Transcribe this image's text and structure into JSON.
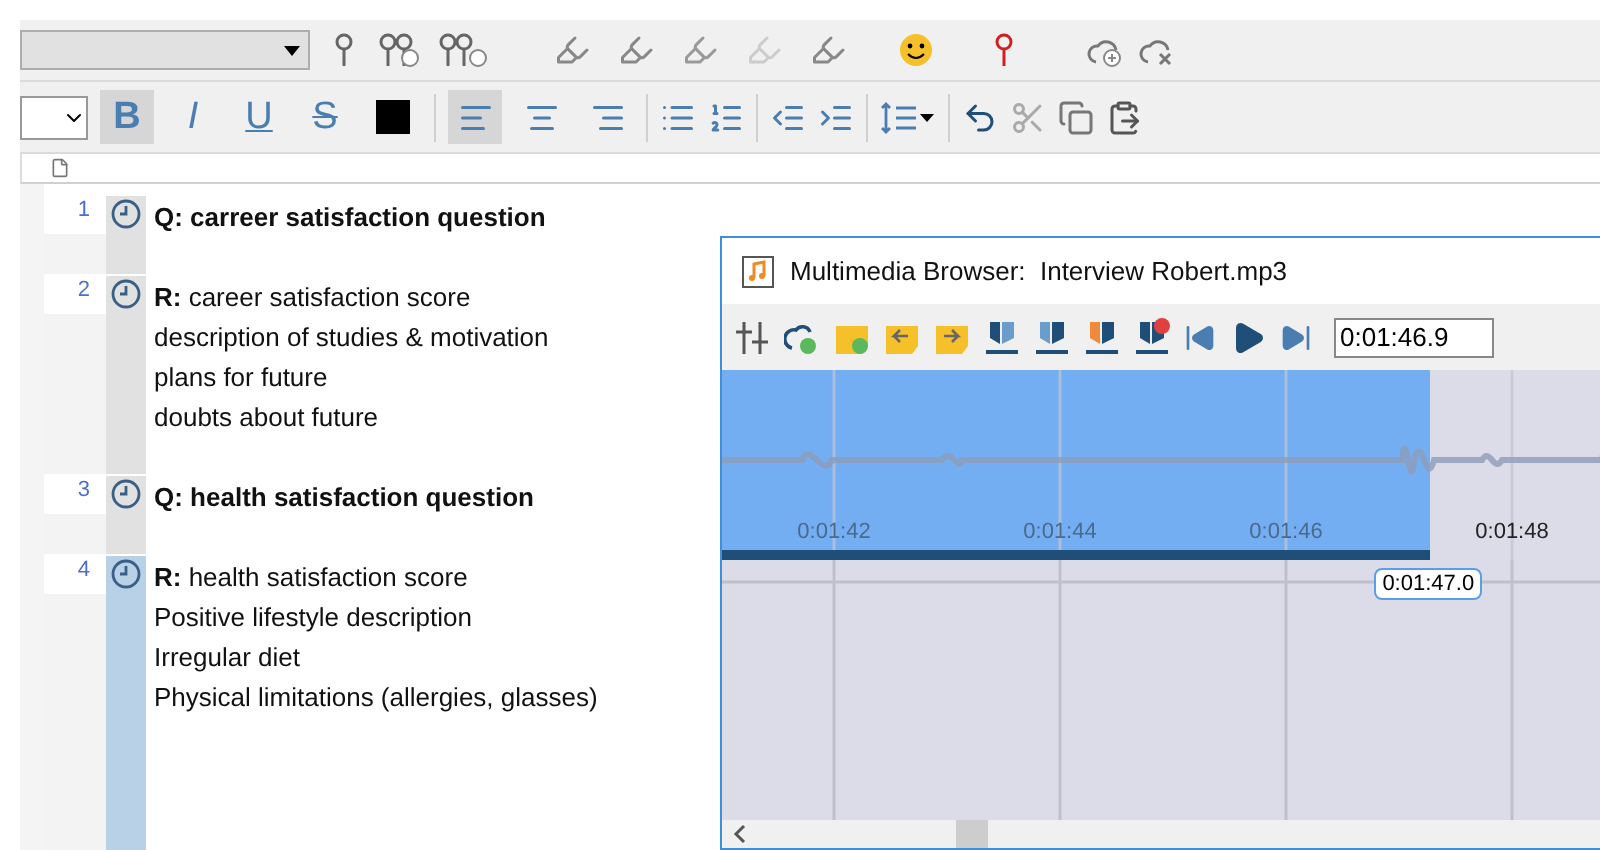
{
  "format_buttons": [
    {
      "label": "B",
      "kind": "bold",
      "pressed": true
    },
    {
      "label": "I",
      "kind": "italic",
      "pressed": false
    },
    {
      "label": "U",
      "kind": "underline",
      "pressed": false
    },
    {
      "label": "S",
      "kind": "strike",
      "pressed": false
    }
  ],
  "align_buttons": [
    {
      "kind": "left",
      "pressed": true
    },
    {
      "kind": "center",
      "pressed": false
    },
    {
      "kind": "right",
      "pressed": false
    }
  ],
  "segments": [
    {
      "number": "1",
      "kind": "question",
      "selected": false,
      "lines": [
        "Q: carreer satisfaction question"
      ]
    },
    {
      "number": "2",
      "kind": "response",
      "selected": false,
      "lines": [
        "**R:** career satisfaction score",
        "description of studies & motivation",
        "plans for future",
        "doubts about future"
      ]
    },
    {
      "number": "3",
      "kind": "question",
      "selected": false,
      "lines": [
        "Q: health satisfaction question"
      ]
    },
    {
      "number": "4",
      "kind": "response",
      "selected": true,
      "lines": [
        "**R:** health satisfaction score",
        "Positive lifestyle description",
        "Irregular diet",
        "Physical limitations (allergies, glasses)"
      ]
    }
  ],
  "media_browser": {
    "title": "Multimedia Browser:  Interview Robert.mp3",
    "time_field": "0:01:46.9",
    "ticks": [
      "0:01:42",
      "0:01:44",
      "0:01:46",
      "0:01:48"
    ],
    "progress": {
      "level": 0.77
    },
    "marker": "0:01:47.0"
  }
}
